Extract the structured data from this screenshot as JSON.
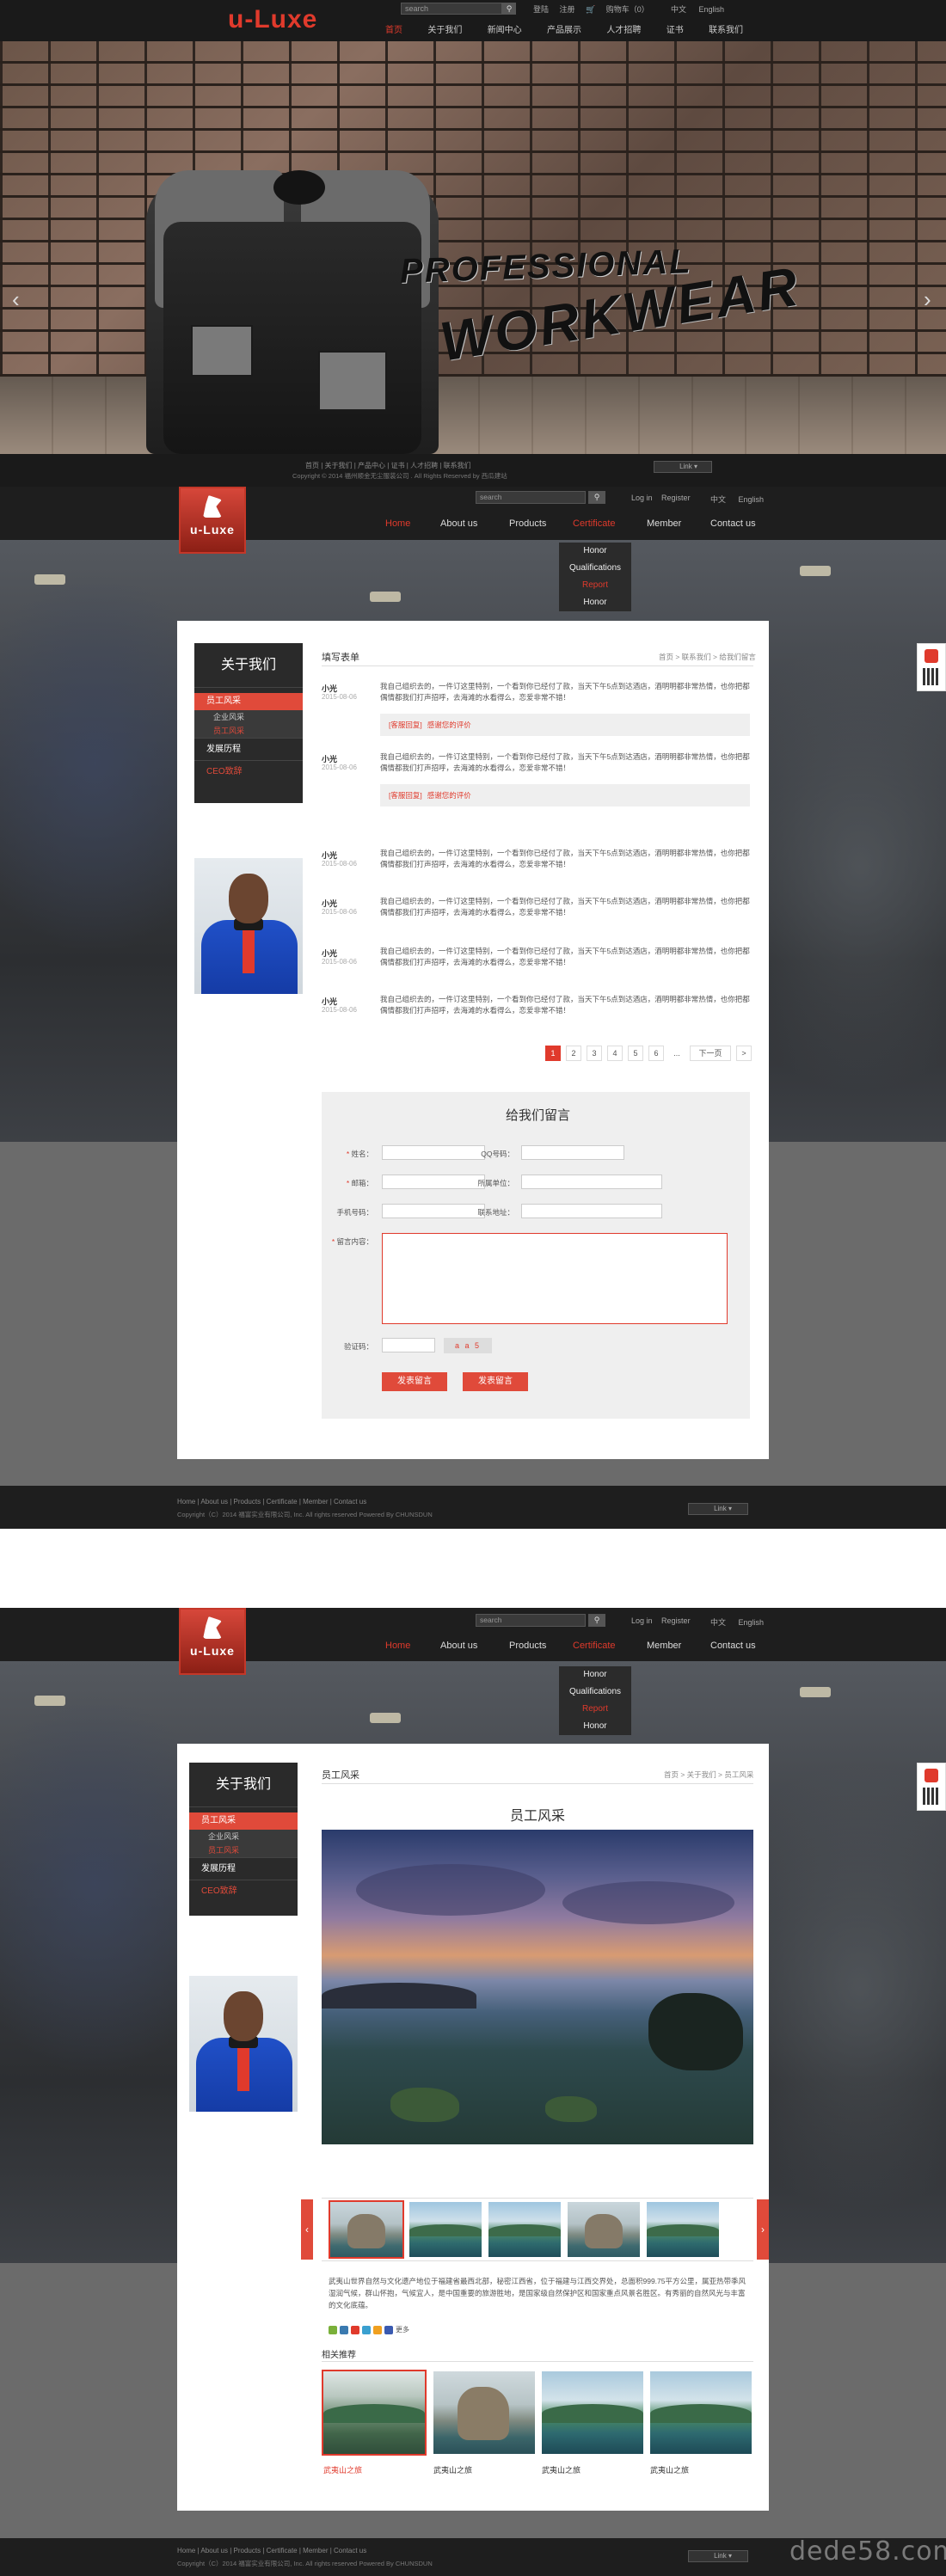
{
  "brand": {
    "logo_text": "u-Luxe",
    "box_word": "u-Luxe",
    "accent": "#e03a2c"
  },
  "home": {
    "search_placeholder": "search",
    "top_links": [
      "登陆",
      "注册"
    ],
    "cart_label": "购物车（0）",
    "lang": [
      "中文",
      "English"
    ],
    "nav": [
      "首页",
      "关于我们",
      "新闻中心",
      "产品展示",
      "人才招聘",
      "证书",
      "联系我们"
    ],
    "banner_title1": "PROFESSIONAL",
    "banner_title2": "WORKWEAR",
    "footer_links": "首页 | 关于我们 | 产品中心 | 证书 | 人才招聘 | 联系我们",
    "footer_copy": "Copyright © 2014 福州顺金无尘服装公司 . All Rights Reserved by 西瓜建站",
    "link_select": "Link"
  },
  "section": {
    "search_placeholder": "search",
    "links": [
      "Log in",
      "Register"
    ],
    "lang": [
      "中文",
      "English"
    ],
    "nav": [
      "Home",
      "About us",
      "Products",
      "Certificate",
      "Member",
      "Contact us"
    ],
    "dropdown": [
      "Honor",
      "Qualifications",
      "Report",
      "Honor"
    ],
    "sidebar": {
      "title": "关于我们",
      "item1": "员工风采",
      "sub1": "企业风采",
      "sub2": "员工风采",
      "item2": "发展历程",
      "item3": "CEO致辞"
    },
    "footer_links": "Home  |  About us  |  Products  |  Certificate  |  Member  |  Contact us",
    "footer_copy": "Copyright（C）2014 福富实业有限公司, Inc. All rights reserved Powered By CHUNSDUN",
    "link_select": "Link"
  },
  "msgpage": {
    "title": "填写表单",
    "breadcrumb": "首页 > 联系我们 > 给我们留言",
    "messages": [
      {
        "name": "小光",
        "date": "2015-08-06",
        "text": "我自己组织去的，一件订这里特别，一个看到你已经付了款，当天下午5点到达酒店，酒明明都非常热情，也你把都偶情都我们打声招呼，去海滩的水看得么，恋爱非常不错！",
        "reply_tag": "[客服回复]",
        "reply_text": "感谢您的评价"
      },
      {
        "name": "小光",
        "date": "2015-08-06",
        "text": "我自己组织去的，一件订这里特别，一个看到你已经付了款，当天下午5点到达酒店，酒明明都非常热情，也你把都偶情都我们打声招呼，去海滩的水看得么，恋爱非常不错！",
        "reply_tag": "[客服回复]",
        "reply_text": "感谢您的评价"
      },
      {
        "name": "小光",
        "date": "2015-08-06",
        "text": "我自己组织去的，一件订这里特别，一个看到你已经付了款，当天下午5点到达酒店，酒明明都非常热情，也你把都偶情都我们打声招呼，去海滩的水看得么，恋爱非常不错！"
      },
      {
        "name": "小光",
        "date": "2015-08-06",
        "text": "我自己组织去的，一件订这里特别，一个看到你已经付了款，当天下午5点到达酒店，酒明明都非常热情，也你把都偶情都我们打声招呼，去海滩的水看得么，恋爱非常不错！"
      },
      {
        "name": "小光",
        "date": "2015-08-06",
        "text": "我自己组织去的，一件订这里特别，一个看到你已经付了款，当天下午5点到达酒店，酒明明都非常热情，也你把都偶情都我们打声招呼，去海滩的水看得么，恋爱非常不错！"
      },
      {
        "name": "小光",
        "date": "2015-08-06",
        "text": "我自己组织去的，一件订这里特别，一个看到你已经付了款，当天下午5点到达酒店，酒明明都非常热情，也你把都偶情都我们打声招呼，去海滩的水看得么，恋爱非常不错！"
      }
    ],
    "pager": [
      "1",
      "2",
      "3",
      "4",
      "5",
      "6",
      "...",
      "下一页",
      ">"
    ],
    "form": {
      "title": "给我们留言",
      "name": "姓名：",
      "qq": "QQ号码：",
      "email": "邮箱：",
      "company": "所属单位：",
      "phone": "手机号码：",
      "address": "联系地址：",
      "content": "留言内容：",
      "captcha_label": "验证码：",
      "captcha_value": "a a 5",
      "submit1": "发表留言",
      "submit2": "发表留言"
    }
  },
  "gallery": {
    "title": "员工风采",
    "breadcrumb": "首页 > 关于我们 > 员工风采",
    "photo_title": "员工风采",
    "description": "武夷山世界自然与文化遗产地位于福建省最西北部，秘密江西省，位于福建与江西交界处，总面积999.75平方公里，属亚热带季风湿润气候，群山怀抱，气候宜人，是中国重要的旅游胜地，是国家级自然保护区和国家重点风景名胜区。有秀丽的自然风光与丰富的文化底蕴。",
    "share_more": "更多",
    "related_title": "相关推荐",
    "related": [
      "武夷山之旅",
      "武夷山之旅",
      "武夷山之旅",
      "武夷山之旅"
    ]
  },
  "watermark": "dede58.com"
}
